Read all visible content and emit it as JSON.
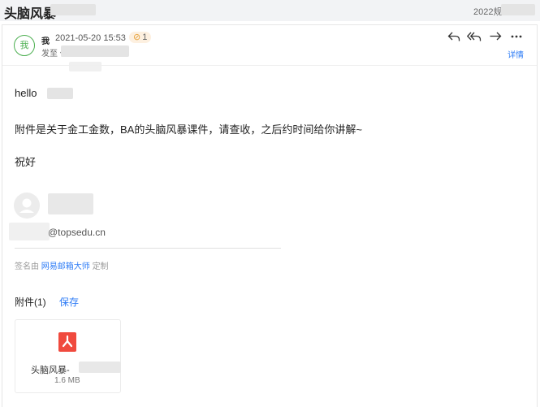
{
  "subject": {
    "title": "头脑风暴",
    "date_prefix": "2022规"
  },
  "header": {
    "sender": "我",
    "time": "2021-05-20 15:53",
    "attachment_count": "1",
    "to_label": "发至",
    "to_first_char": "仆",
    "details_label": "详情",
    "actions": [
      "reply-icon",
      "reply-all-icon",
      "forward-icon",
      "more-icon"
    ]
  },
  "body": {
    "greeting": "hello",
    "line1": "附件是关于金工金数，BA的头脑风暴课件，请查收，之后约时间给你讲解~",
    "closing": "祝好"
  },
  "signature": {
    "email_domain": "@topsedu.cn",
    "footer_prefix": "签名由",
    "footer_link": "网易邮箱大师",
    "footer_suffix": "定制"
  },
  "attachments": {
    "title": "附件(1)",
    "save_label": "保存",
    "items": [
      {
        "name": "头脑风暴-",
        "size": "1.6 MB",
        "icon": "pdf-icon"
      }
    ]
  },
  "colors": {
    "accent": "#2e7cf6",
    "avatar_green": "#4caf50",
    "pdf_red": "#f04a3e"
  }
}
